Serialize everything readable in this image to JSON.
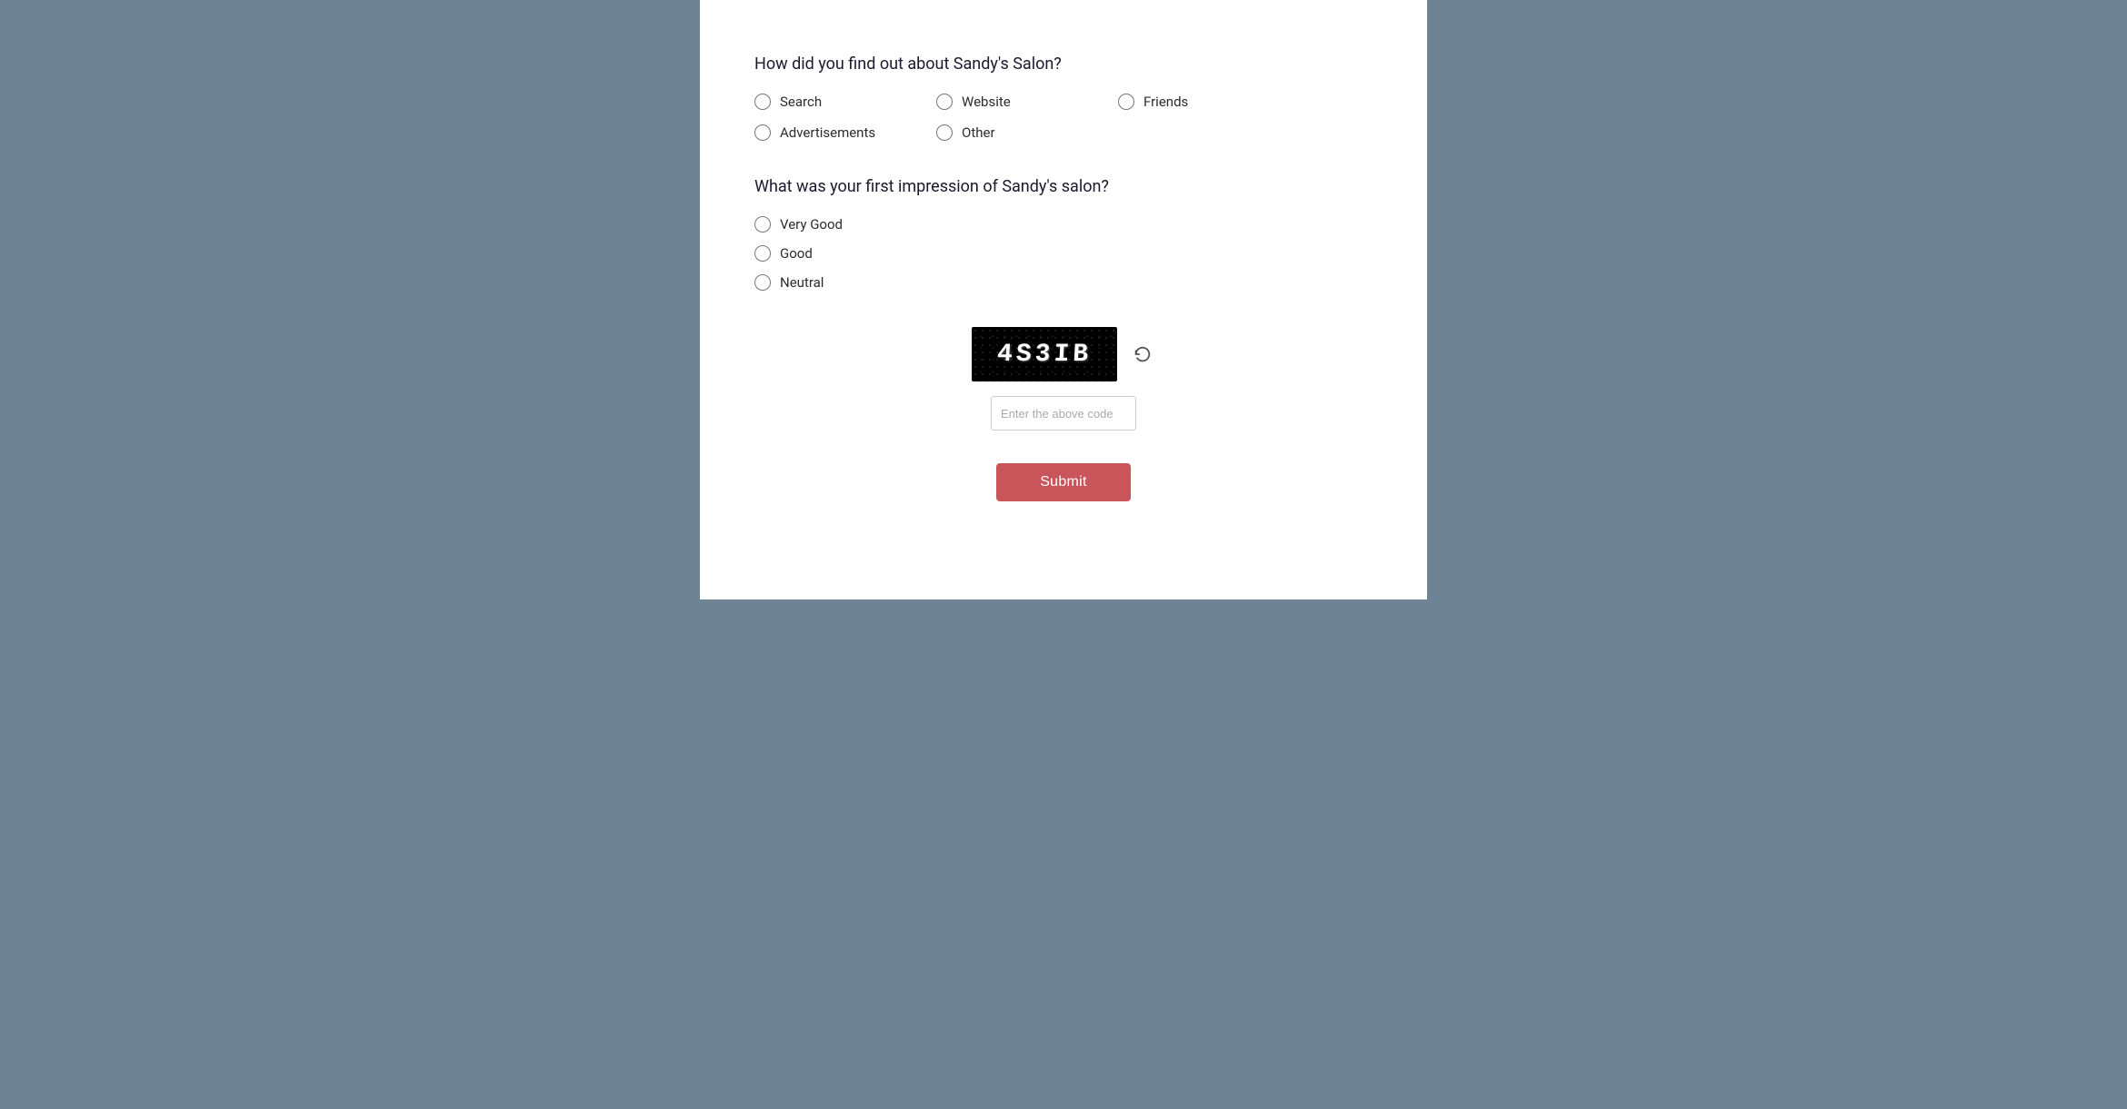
{
  "questions": {
    "q1": {
      "title": "How did you find out about Sandy's Salon?",
      "options": [
        {
          "id": "search",
          "label": "Search"
        },
        {
          "id": "website",
          "label": "Website"
        },
        {
          "id": "friends",
          "label": "Friends"
        },
        {
          "id": "advertisements",
          "label": "Advertisements"
        },
        {
          "id": "other",
          "label": "Other"
        }
      ]
    },
    "q2": {
      "title": "What was your first impression of Sandy's salon?",
      "options": [
        {
          "id": "very-good",
          "label": "Very Good"
        },
        {
          "id": "good",
          "label": "Good"
        },
        {
          "id": "neutral",
          "label": "Neutral"
        }
      ]
    }
  },
  "captcha": {
    "code": "4S3IB",
    "input_placeholder": "Enter the above code",
    "refresh_label": "refresh"
  },
  "submit": {
    "label": "Submit"
  }
}
